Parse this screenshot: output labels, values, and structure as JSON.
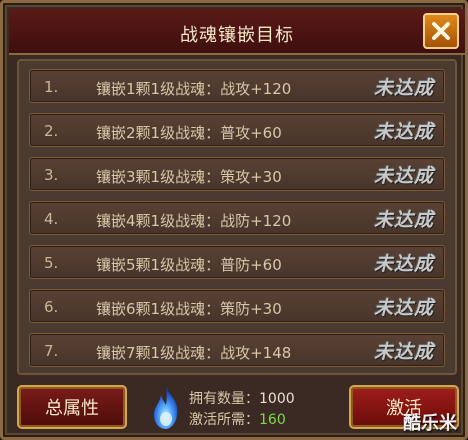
{
  "title": "战魂镶嵌目标",
  "close_icon": "close-icon",
  "rows": [
    {
      "num": "1.",
      "desc": "镶嵌1颗1级战魂：战攻+120",
      "status": "未达成"
    },
    {
      "num": "2.",
      "desc": "镶嵌2颗1级战魂：普攻+60",
      "status": "未达成"
    },
    {
      "num": "3.",
      "desc": "镶嵌3颗1级战魂：策攻+30",
      "status": "未达成"
    },
    {
      "num": "4.",
      "desc": "镶嵌4颗1级战魂：战防+120",
      "status": "未达成"
    },
    {
      "num": "5.",
      "desc": "镶嵌5颗1级战魂：普防+60",
      "status": "未达成"
    },
    {
      "num": "6.",
      "desc": "镶嵌6颗1级战魂：策防+30",
      "status": "未达成"
    },
    {
      "num": "7.",
      "desc": "镶嵌7颗1级战魂：战攻+148",
      "status": "未达成"
    }
  ],
  "footer": {
    "attr_button": "总属性",
    "activate_button": "激活",
    "own_label": "拥有数量：",
    "own_value": "1000",
    "need_label": "激活所需：",
    "need_value": "160",
    "flame_icon": "blue-flame-icon"
  },
  "watermark": "酷乐米",
  "colors": {
    "title_bar": "#4a1412",
    "border_gold": "#d6a64a",
    "need_value": "#7fd84a",
    "close_button": "#e08a1a"
  }
}
